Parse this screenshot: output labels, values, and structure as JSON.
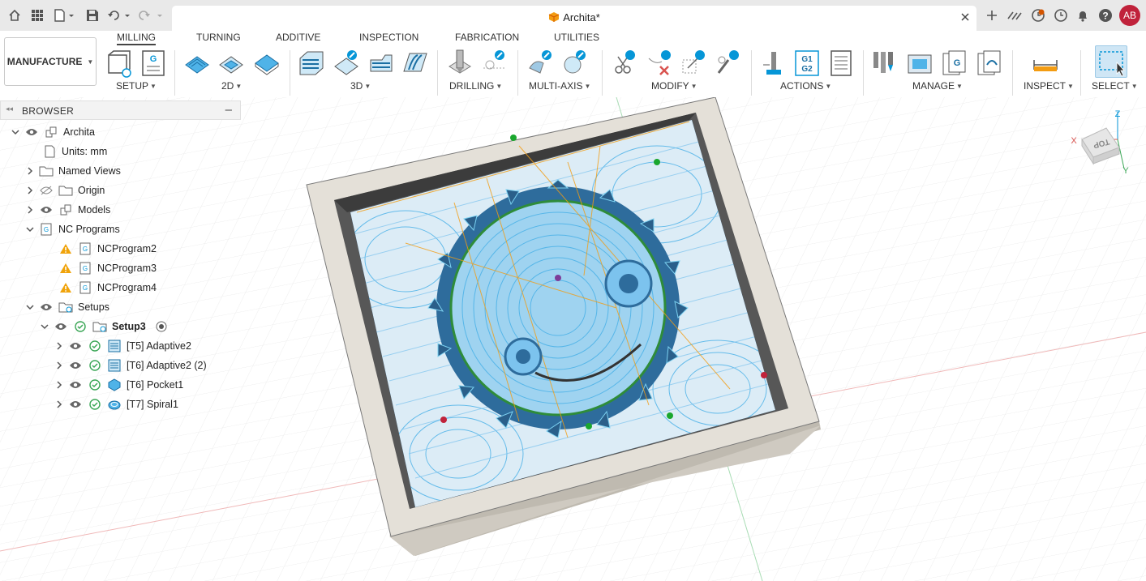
{
  "app": {
    "document_title": "Archita*",
    "user_initials": "AB"
  },
  "workspace": {
    "label": "MANUFACTURE"
  },
  "tabs": [
    "MILLING",
    "TURNING",
    "ADDITIVE",
    "INSPECTION",
    "FABRICATION",
    "UTILITIES"
  ],
  "groups": [
    "SETUP",
    "2D",
    "3D",
    "DRILLING",
    "MULTI-AXIS",
    "MODIFY",
    "ACTIONS",
    "MANAGE",
    "INSPECT",
    "SELECT"
  ],
  "browser": {
    "title": "BROWSER",
    "root": "Archita",
    "units": "Units: mm",
    "named_views": "Named Views",
    "origin": "Origin",
    "models": "Models",
    "nc_programs": "NC Programs",
    "programs": [
      "NCProgram2",
      "NCProgram3",
      "NCProgram4"
    ],
    "setups": "Setups",
    "setup": "Setup3",
    "operations": [
      "[T5] Adaptive2",
      "[T6] Adaptive2 (2)",
      "[T6] Pocket1",
      "[T7] Spiral1"
    ]
  },
  "viewcube": {
    "face": "TOP",
    "x": "X",
    "y": "Y",
    "z": "Z"
  },
  "colors": {
    "accent": "#0696d7",
    "warning": "#f0a30a",
    "ok": "#3aa655",
    "avatar": "#c0223b",
    "toolpath": "#4fb3e8",
    "stock": "#e4e0d8"
  }
}
